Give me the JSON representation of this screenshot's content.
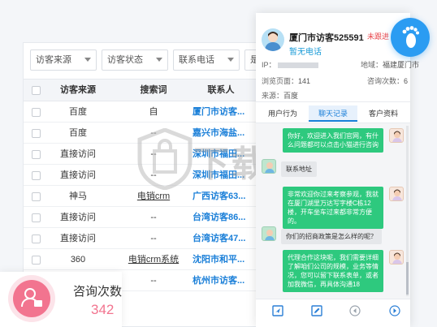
{
  "filters": [
    {
      "label": "访客来源"
    },
    {
      "label": "访客状态"
    },
    {
      "label": "联系电话"
    },
    {
      "label": "是"
    }
  ],
  "table": {
    "headers": {
      "source": "访客来源",
      "keyword": "搜索词",
      "contact": "联系人"
    },
    "rows": [
      {
        "source": "百度",
        "keyword": "自",
        "contact": "厦门市访客..."
      },
      {
        "source": "百度",
        "keyword": "--",
        "contact": "嘉兴市海盐..."
      },
      {
        "source": "直接访问",
        "keyword": "--",
        "contact": "深圳市福田..."
      },
      {
        "source": "直接访问",
        "keyword": "--",
        "contact": "深圳市福田..."
      },
      {
        "source": "神马",
        "keyword": "电销crm",
        "contact": "广西访客63..."
      },
      {
        "source": "直接访问",
        "keyword": "--",
        "contact": "台湾访客86..."
      },
      {
        "source": "直接访问",
        "keyword": "--",
        "contact": "台湾访客47..."
      },
      {
        "source": "360",
        "keyword": "电销crm系统",
        "contact": "沈阳市和平..."
      },
      {
        "source": "",
        "keyword": "--",
        "contact": "杭州市访客..."
      }
    ]
  },
  "watermark": "下载",
  "stat_card": {
    "label": "咨询次数",
    "value": "342",
    "accent": "#f2748f"
  },
  "chat": {
    "visitor_name": "厦门市访客525591",
    "phone_prompt": "暂无电话",
    "status": "未跟进",
    "info": {
      "ip_label": "IP：",
      "region_label": "地域：",
      "region_value": "福建厦门市",
      "views_label": "浏览页面：",
      "views_value": "141",
      "consult_label": "咨询次数：",
      "consult_value": "6",
      "source_label": "来源：",
      "source_value": "百度"
    },
    "tabs": [
      "用户行为",
      "聊天记录",
      "客户资料"
    ],
    "messages": [
      {
        "from": "staff",
        "text": "你好，欢迎进入我们官网，有什么问题都可以点击小猫进行咨询"
      },
      {
        "from": "visitor",
        "text": "联系地址"
      },
      {
        "from": "staff",
        "text": "非常欢迎你过来考察参观，我就在厦门湖里万达写字楼C栋12楼，开车坐车过来都非常方便的。"
      },
      {
        "from": "visitor",
        "text": "你们的招商政策是怎么样的呢？"
      },
      {
        "from": "staff",
        "text": "代理合作这块呢，我们需要详细了解咱们公司的规模，业务等情况，您可以留下联系表单，或者加我微信，再具体沟通18"
      }
    ],
    "accent": "#2b9cf2",
    "bubble_color": "#2ec97e"
  }
}
